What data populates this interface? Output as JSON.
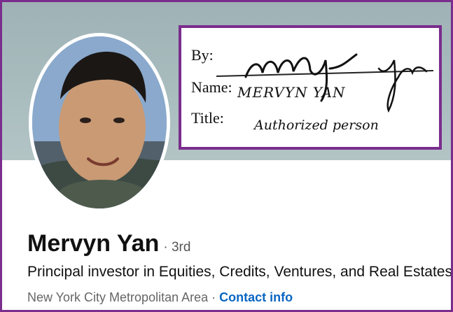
{
  "profile": {
    "name": "Mervyn Yan",
    "degree": "· 3rd",
    "headline": "Principal investor in Equities, Credits, Ventures, and Real Estates",
    "location": "New York City Metropolitan Area",
    "separator": "·",
    "contact_label": "Contact info"
  },
  "signature_block": {
    "by_label": "By:",
    "name_label": "Name:",
    "title_label": "Title:",
    "name_value": "MERVYN YAN",
    "title_value": "Authorized person"
  },
  "colors": {
    "frame": "#7a2d8c",
    "link": "#0a66c2",
    "banner": "#a8bcbe"
  },
  "icons": [
    "profile-photo",
    "handwritten-signature"
  ]
}
